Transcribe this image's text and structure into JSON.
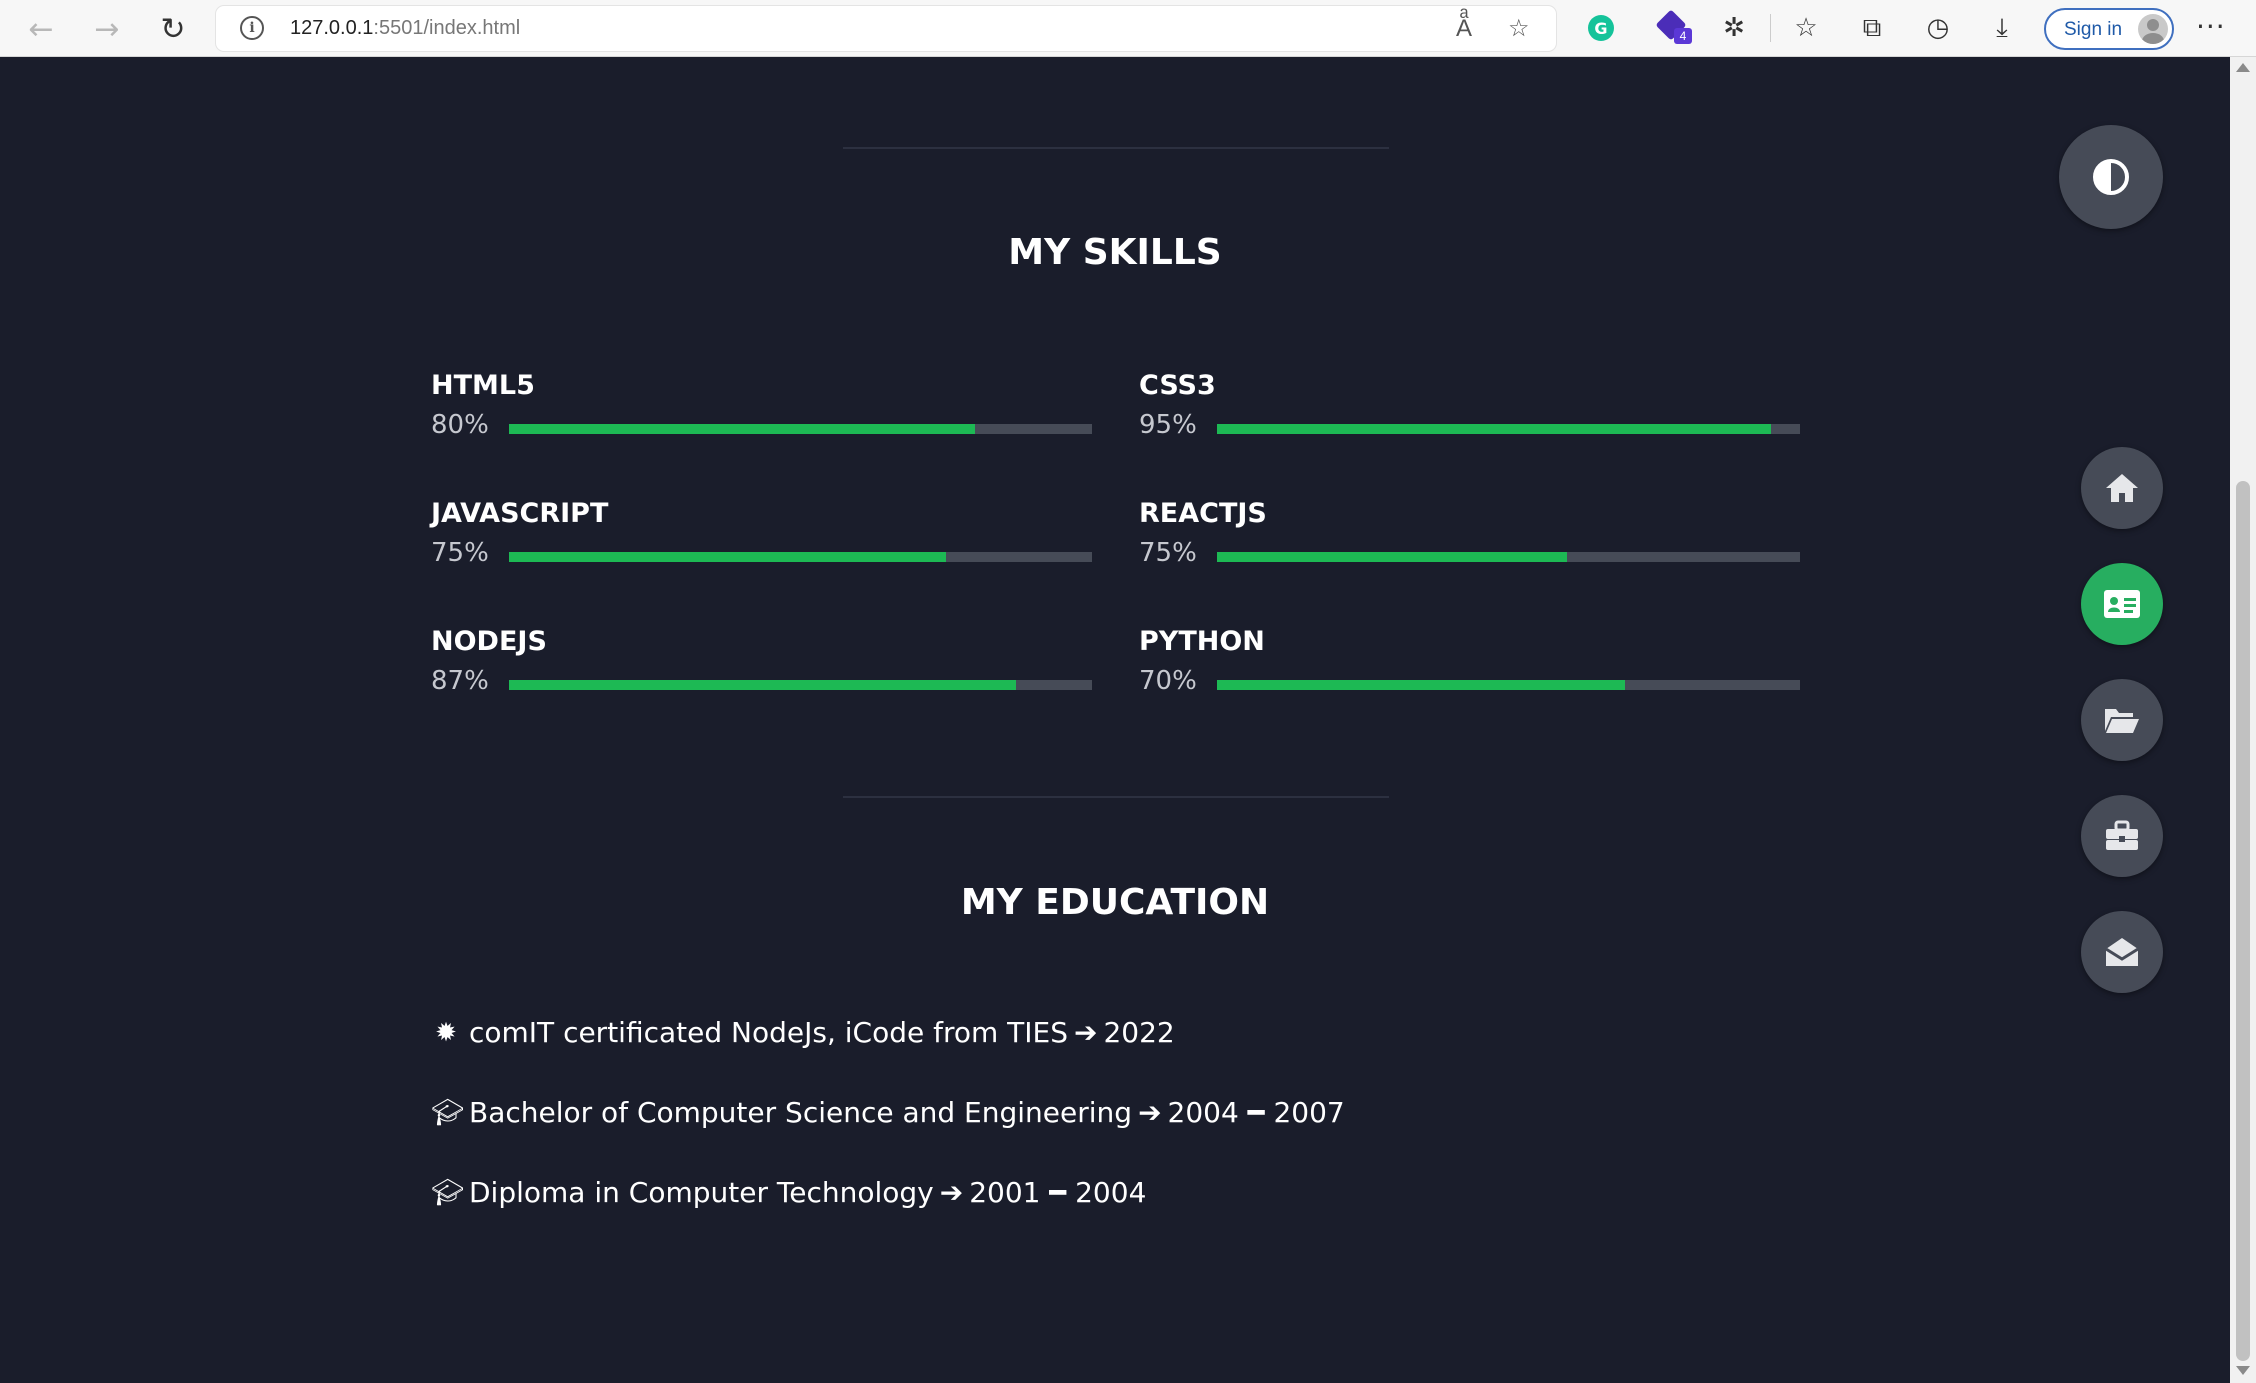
{
  "browser": {
    "url_host": "127.0.0.1",
    "url_rest": ":5501/index.html",
    "ext_badge_count": "4",
    "signin_label": "Sign in"
  },
  "skills": {
    "title": "MY SKILLS",
    "items": [
      {
        "name": "HTML5",
        "percent_label": "80%",
        "level": 0.8
      },
      {
        "name": "CSS3",
        "percent_label": "95%",
        "level": 0.95
      },
      {
        "name": "JAVASCRIPT",
        "percent_label": "75%",
        "level": 0.75
      },
      {
        "name": "REACTJS",
        "percent_label": "75%",
        "level": 0.6
      },
      {
        "name": "NODEJS",
        "percent_label": "87%",
        "level": 0.87
      },
      {
        "name": "PYTHON",
        "percent_label": "70%",
        "level": 0.7
      }
    ]
  },
  "education": {
    "title": "MY EDUCATION",
    "items": [
      {
        "icon": "certificate-icon",
        "text": "comIT certificated NodeJs, iCode from TIES",
        "period": "2022"
      },
      {
        "icon": "graduation-cap-icon",
        "text": "Bachelor of Computer Science and Engineering",
        "period": "2004 ━ 2007"
      },
      {
        "icon": "graduation-cap-icon",
        "text": "Diploma in Computer Technology",
        "period": "2001 ━ 2004"
      }
    ]
  },
  "colors": {
    "background": "#1a1d2b",
    "accent": "#1db954",
    "track": "#464b57",
    "button": "#464b57",
    "active_button": "#27ae60"
  },
  "side_nav": [
    {
      "icon": "home-icon",
      "active": false
    },
    {
      "icon": "id-card-icon",
      "active": true
    },
    {
      "icon": "folder-open-icon",
      "active": false
    },
    {
      "icon": "briefcase-icon",
      "active": false
    },
    {
      "icon": "envelope-open-icon",
      "active": false
    }
  ]
}
